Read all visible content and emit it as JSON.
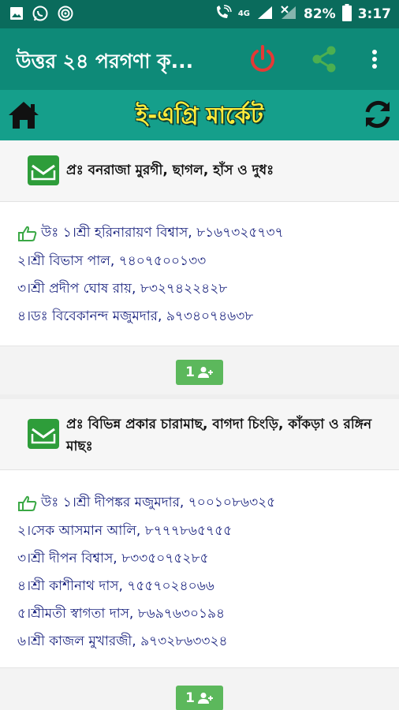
{
  "status_bar": {
    "network": "4G",
    "battery": "82%",
    "time": "3:17"
  },
  "app_bar": {
    "title": "উত্তর ২৪ পরগণা কৃ...",
    "accent_power": "#e53935",
    "accent_share": "#4caf50"
  },
  "sub_bar": {
    "title": "ই-এগ্রি মার্কেট"
  },
  "cards": [
    {
      "question": "প্রঃ বনরাজা মুরগী, ছাগল, হাঁস ও দুধঃ",
      "answers": [
        "উঃ ১।শ্রী হরিনারায়ণ বিশ্বাস, ৮১৬৭৩২৫৭৩৭",
        "২।শ্রী বিভাস পাল, ৭৪০৭৫০০১৩৩",
        "৩।শ্রী প্রদীপ ঘোষ রায়, ৮৩২৭৪২২৪২৮",
        "৪।ডঃ বিবেকানন্দ মজুমদার, ৯৭৩৪০৭৪৬৩৮"
      ],
      "add_count": "1"
    },
    {
      "question": "প্রঃ বিভিন্ন প্রকার চারামাছ, বাগদা চিংড়ি, কাঁকড়া ও রঙ্গিন মাছঃ",
      "answers": [
        "উঃ ১।শ্রী দীপঙ্কর মজুমদার, ৭০০১০৮৬৩২৫",
        "২।সেক আসমান আলি, ৮৭৭৭৮৬৫৭৫৫",
        "৩।শ্রী দীপন বিশ্বাস, ৮৩৩৫০৭৫২৮৫",
        "৪।শ্রী কাশীনাথ দাস, ৭৫৫৭০২৪০৬৬",
        "৫।শ্রীমতী স্বাগতা দাস, ৮৬৯৭৬৩০১৯৪",
        "৬।শ্রী কাজল মুখারজী, ৯৭৩২৮৬৩৩২৪"
      ],
      "add_count": "1"
    }
  ]
}
